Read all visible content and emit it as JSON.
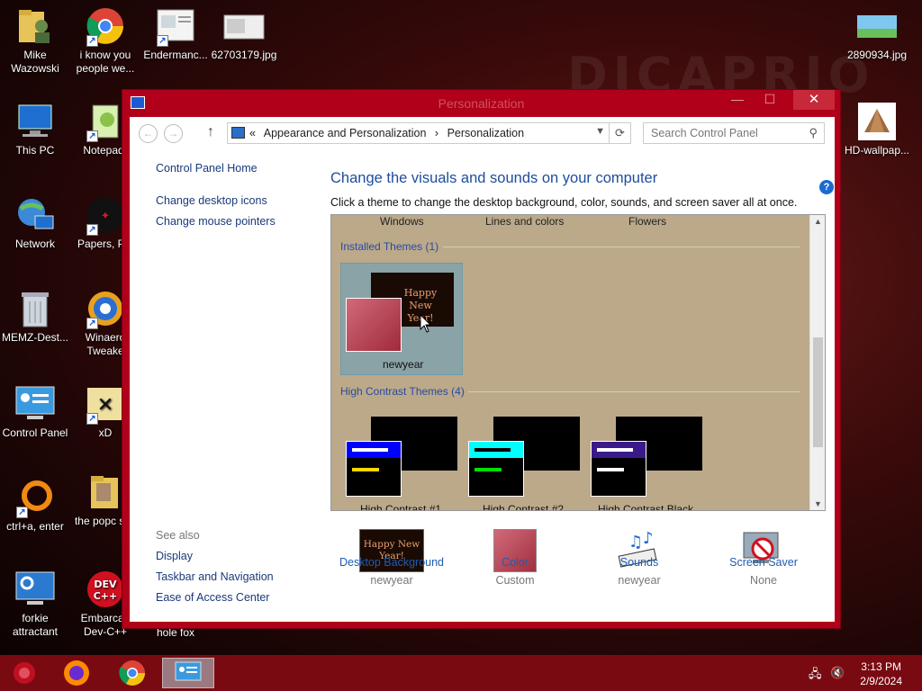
{
  "desktop": {
    "icons": [
      {
        "label": "Mike Wazowski"
      },
      {
        "label": "i know you people we..."
      },
      {
        "label": "Endermanc..."
      },
      {
        "label": "62703179.jpg"
      },
      {
        "label": "2890934.jpg"
      },
      {
        "label": "This PC"
      },
      {
        "label": "Notepad-"
      },
      {
        "label": "HD-wallpap..."
      },
      {
        "label": "Network"
      },
      {
        "label": "Papers, Ple"
      },
      {
        "label": "MEMZ-Dest..."
      },
      {
        "label": "Winaero Tweake"
      },
      {
        "label": "Control Panel"
      },
      {
        "label": "xD"
      },
      {
        "label": "ctrl+a, enter"
      },
      {
        "label": "the popc shit"
      },
      {
        "label": "forkie attractant"
      },
      {
        "label": "Embarcad Dev-C++"
      },
      {
        "label": "hole fox"
      }
    ]
  },
  "window": {
    "title": "Personalization",
    "minimize": "—",
    "maximize": "☐",
    "close": "✕",
    "address": {
      "prefix": "«",
      "crumb1": "Appearance and Personalization",
      "sep": "›",
      "crumb2": "Personalization"
    },
    "search_placeholder": "Search Control Panel",
    "left_nav": {
      "home": "Control Panel Home",
      "desktop_icons": "Change desktop icons",
      "mouse_pointers": "Change mouse pointers"
    },
    "see_also": {
      "header": "See also",
      "display": "Display",
      "taskbar": "Taskbar and Navigation",
      "ease": "Ease of Access Center"
    },
    "main": {
      "title": "Change the visuals and sounds on your computer",
      "subtitle": "Click a theme to change the desktop background, color, sounds, and screen saver all at once."
    },
    "themes": {
      "top_row": [
        "Windows",
        "Lines and colors",
        "Flowers"
      ],
      "installed_header": "Installed Themes (1)",
      "installed": {
        "name": "newyear",
        "thumb_text": "Happy New Year!"
      },
      "hc_header": "High Contrast Themes (4)",
      "hc": [
        {
          "name": "High Contrast #1",
          "bar_top": "#0000ff",
          "line1": "#ffffff",
          "line2": "#ffd700"
        },
        {
          "name": "High Contrast #2",
          "bar_top": "#00ffff",
          "line1": "#000000",
          "line2": "#00e000"
        },
        {
          "name": "High Contrast Black",
          "bar_top": "#3a1a8a",
          "line1": "#ffffff",
          "line2": "#ffffff"
        }
      ]
    },
    "bottom": [
      {
        "link": "Desktop Background",
        "value": "newyear",
        "thumb_text": "Happy New Year!"
      },
      {
        "link": "Color",
        "value": "Custom"
      },
      {
        "link": "Sounds",
        "value": "newyear"
      },
      {
        "link": "Screen Saver",
        "value": "None"
      }
    ]
  },
  "taskbar": {
    "time": "3:13 PM",
    "date": "2/9/2024"
  },
  "colors": {
    "window_frame": "#b0001a",
    "taskbar": "#7a0a12",
    "link": "#1e5cb0",
    "theme_bg": "#bba98a"
  }
}
